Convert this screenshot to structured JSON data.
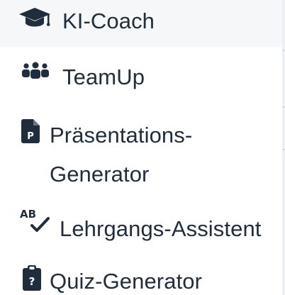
{
  "menu": {
    "items": [
      {
        "id": "ki-coach",
        "label": "KI-Coach",
        "icon": "graduation-cap-icon"
      },
      {
        "id": "teamup",
        "label": "TeamUp",
        "icon": "users-group-icon"
      },
      {
        "id": "praesentations-generator",
        "label": "Präsentations-Generator",
        "label_line1": "Präsentations-",
        "label_line2": "Generator",
        "icon": "presentation-file-icon"
      },
      {
        "id": "lehrgangs-assistent",
        "label": "Lehrgangs-Assistent",
        "icon": "ab-check-icon"
      },
      {
        "id": "quiz-generator",
        "label": "Quiz-Generator",
        "icon": "clipboard-question-icon"
      }
    ]
  },
  "colors": {
    "text": "#1f2d3d",
    "icon": "#1f2d3d",
    "hover_background": "#f5f7f9",
    "background": "#ffffff"
  }
}
